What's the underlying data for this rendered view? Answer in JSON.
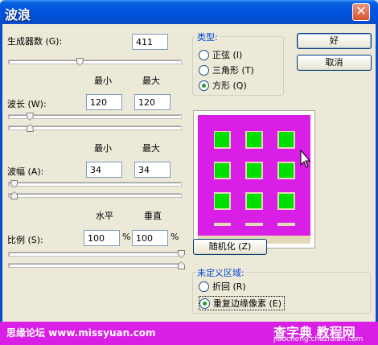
{
  "window": {
    "title": "波浪",
    "close_glyph": "✕"
  },
  "generators": {
    "label": "生成器数 (G):",
    "value": "411",
    "slider_fraction": 0.41
  },
  "min_max_header": {
    "min": "最小",
    "max": "最大"
  },
  "wavelength": {
    "label": "波长 (W):",
    "min": "120",
    "max": "120",
    "slider_min_fraction": 0.12,
    "slider_max_fraction": 0.12
  },
  "amplitude": {
    "label": "波幅 (A):",
    "min": "34",
    "max": "34",
    "slider_min_fraction": 0.03,
    "slider_max_fraction": 0.03
  },
  "scale_header": {
    "horizontal": "水平",
    "vertical": "垂直"
  },
  "scale": {
    "label": "比例 (S):",
    "horizontal": "100",
    "vertical": "100",
    "unit": "%",
    "slider_h_fraction": 1.0,
    "slider_v_fraction": 1.0
  },
  "type_group": {
    "title": "类型:",
    "options": [
      {
        "label": "正弦 (I)",
        "selected": false
      },
      {
        "label": "三角形 (T)",
        "selected": false
      },
      {
        "label": "方形 (Q)",
        "selected": true
      }
    ]
  },
  "buttons": {
    "ok": "好",
    "cancel": "取消",
    "randomize": "随机化 (Z)"
  },
  "preview": {
    "magenta": "#d91ee6",
    "green": "#00e000",
    "tan": "#e4d9b6"
  },
  "undefined_area": {
    "title": "未定义区域:",
    "options": [
      {
        "label": "折回 (R)",
        "selected": false
      },
      {
        "label": "重复边缘像素 (E)",
        "selected": true
      }
    ]
  },
  "watermark": {
    "left": "思缘论坛 www.missyuan.com",
    "right": "查字典 教程网",
    "sub": "jiaocheng.chazidian.com"
  }
}
